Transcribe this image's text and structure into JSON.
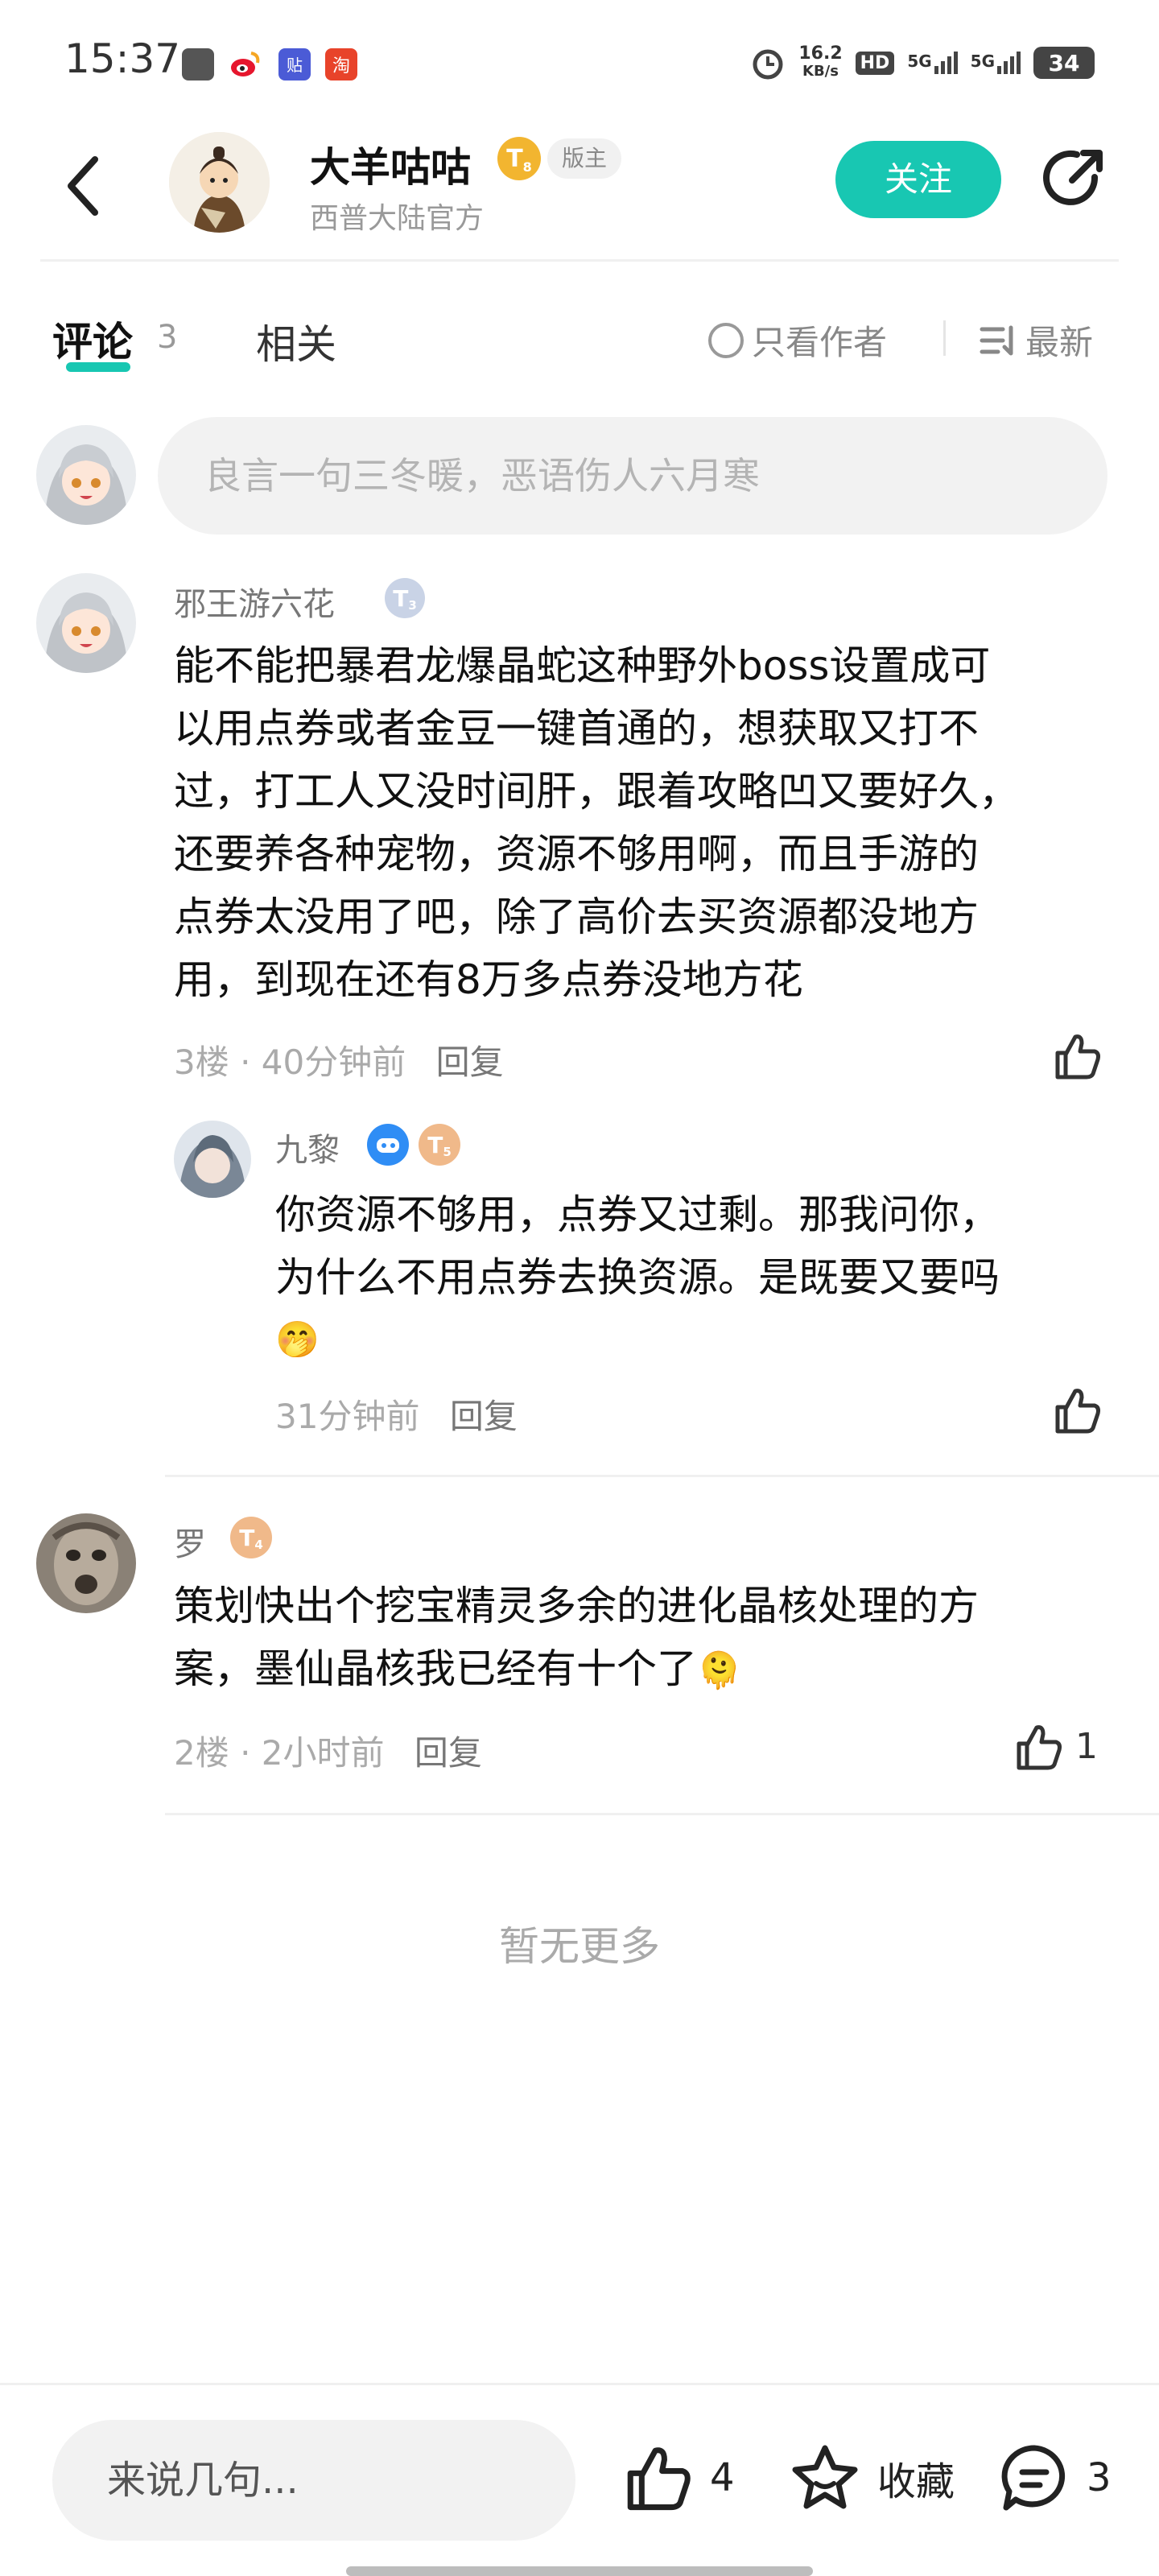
{
  "status_bar": {
    "time": "15:37",
    "net_speed_value": "16.2",
    "net_speed_unit": "KB/s",
    "hd": "HD",
    "sim1": "5G",
    "sim2": "5G",
    "battery": "34",
    "icons": [
      "square-icon",
      "weibo-icon",
      "tieba-icon",
      "taobao-icon",
      "alarm-icon",
      "hd-icon",
      "signal-icon",
      "signal-icon",
      "battery-icon"
    ]
  },
  "header": {
    "author_name": "大羊咕咕",
    "level_badge": "T",
    "level_num": "8",
    "role_badge": "版主",
    "author_sub": "西普大陆官方",
    "follow_label": "关注"
  },
  "tabs": {
    "comments_label": "评论",
    "comments_count": "3",
    "related_label": "相关",
    "only_author_label": "只看作者",
    "sort_label": "最新"
  },
  "composer": {
    "placeholder": "良言一句三冬暖，恶语伤人六月寒"
  },
  "comments": [
    {
      "user": "邪王游六花",
      "level": "T",
      "level_num": "3",
      "text_lines": [
        "能不能把暴君龙爆晶蛇这种野外boss设置成可",
        "以用点券或者金豆一键首通的，想获取又打不",
        "过，打工人又没时间肝，跟着攻略凹又要好久，",
        "还要养各种宠物，资源不够用啊，而且手游的",
        "点券太没用了吧，除了高价去买资源都没地方",
        "用，到现在还有8万多点券没地方花"
      ],
      "floor": "3楼",
      "time": "40分钟前",
      "reply_label": "回复"
    },
    {
      "user": "九黎",
      "level": "T",
      "level_num": "5",
      "text_lines": [
        "你资源不够用，点券又过剩。那我问你，",
        "为什么不用点券去换资源。是既要又要吗"
      ],
      "emoji": "🤭",
      "time": "31分钟前",
      "reply_label": "回复"
    },
    {
      "user": "罗",
      "level": "T",
      "level_num": "4",
      "text_lines": [
        "策划快出个挖宝精灵多余的进化晶核处理的方",
        "案，墨仙晶核我已经有十个了"
      ],
      "emoji": "🫠",
      "floor": "2楼",
      "time": "2小时前",
      "reply_label": "回复",
      "likes": "1"
    }
  ],
  "no_more": "暂无更多",
  "bottom_bar": {
    "input_placeholder": "来说几句...",
    "like_count": "4",
    "favorite_label": "收藏",
    "comment_count": "3"
  },
  "colors": {
    "accent": "#18c7b2",
    "gold_badge": "#f2b530",
    "muted_text": "#aaaaaa"
  }
}
